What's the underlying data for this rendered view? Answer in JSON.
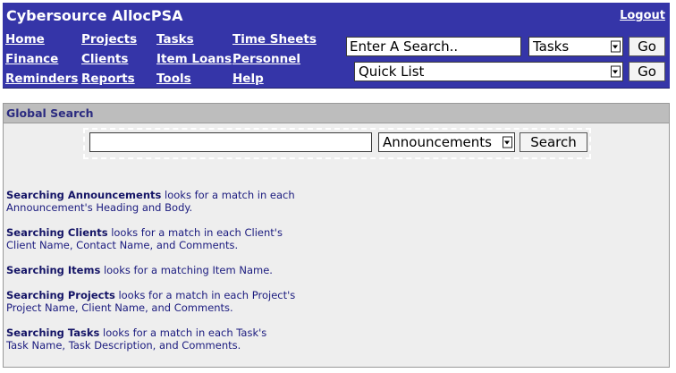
{
  "header": {
    "app_title": "Cybersource AllocPSA",
    "logout_label": "Logout",
    "nav": [
      {
        "label": "Home"
      },
      {
        "label": "Projects"
      },
      {
        "label": "Tasks"
      },
      {
        "label": "Time Sheets"
      },
      {
        "label": "Finance"
      },
      {
        "label": "Clients"
      },
      {
        "label": "Item Loans"
      },
      {
        "label": "Personnel"
      },
      {
        "label": "Reminders"
      },
      {
        "label": "Reports"
      },
      {
        "label": "Tools"
      },
      {
        "label": "Help"
      }
    ],
    "quick_search": {
      "input_value": "Enter A Search..",
      "category_selected": "Tasks",
      "go_label": "Go"
    },
    "quick_list": {
      "selected": "Quick List",
      "go_label": "Go"
    }
  },
  "global_search": {
    "title": "Global Search",
    "input_value": "",
    "category_selected": "Announcements",
    "search_label": "Search",
    "help": [
      {
        "term": "Searching Announcements",
        "line1": " looks for a match in each",
        "line2": "Announcement's Heading and Body."
      },
      {
        "term": "Searching Clients",
        "line1": " looks for a match in each Client's",
        "line2": "Client Name, Contact Name, and Comments."
      },
      {
        "term": "Searching Items",
        "line1": " looks for a matching Item Name.",
        "line2": ""
      },
      {
        "term": "Searching Projects",
        "line1": " looks for a match in each Project's",
        "line2": "Project Name, Client Name, and Comments."
      },
      {
        "term": "Searching Tasks",
        "line1": " looks for a match in each Task's",
        "line2": "Task Name, Task Description, and Comments."
      }
    ]
  }
}
